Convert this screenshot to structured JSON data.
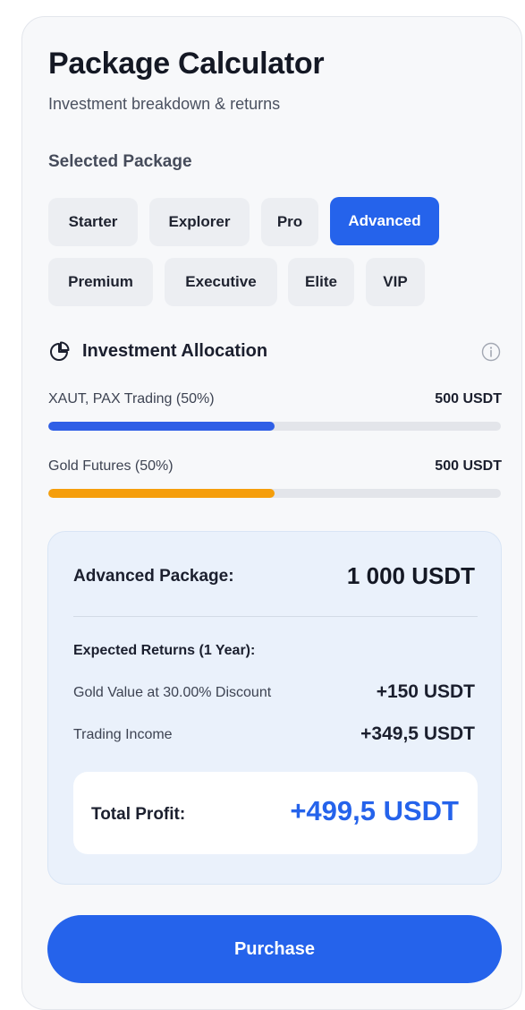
{
  "header": {
    "title": "Package Calculator",
    "subtitle": "Investment breakdown & returns"
  },
  "package_selector": {
    "label": "Selected Package",
    "selected": "Advanced",
    "options": [
      "Starter",
      "Explorer",
      "Pro",
      "Advanced",
      "Premium",
      "Executive",
      "Elite",
      "VIP"
    ]
  },
  "allocation": {
    "title": "Investment Allocation",
    "icon": "pie-chart-icon",
    "info_icon": "info-icon",
    "items": [
      {
        "label": "XAUT, PAX Trading (50%)",
        "value": "500 USDT",
        "share": 0.5,
        "color": "#2f5fe6"
      },
      {
        "label": "Gold Futures (50%)",
        "value": "500 USDT",
        "share": 0.5,
        "color": "#f59e0b"
      }
    ]
  },
  "summary": {
    "package_label": "Advanced Package:",
    "package_value": "1 000 USDT",
    "returns_heading": "Expected Returns (1 Year):",
    "returns": [
      {
        "label": "Gold Value at 30.00% Discount",
        "value": "+150 USDT"
      },
      {
        "label": "Trading Income",
        "value": "+349,5 USDT"
      }
    ],
    "total_label": "Total Profit:",
    "total_value": "+499,5 USDT"
  },
  "actions": {
    "purchase_label": "Purchase"
  },
  "colors": {
    "accent": "#2563eb",
    "gold": "#f59e0b"
  }
}
